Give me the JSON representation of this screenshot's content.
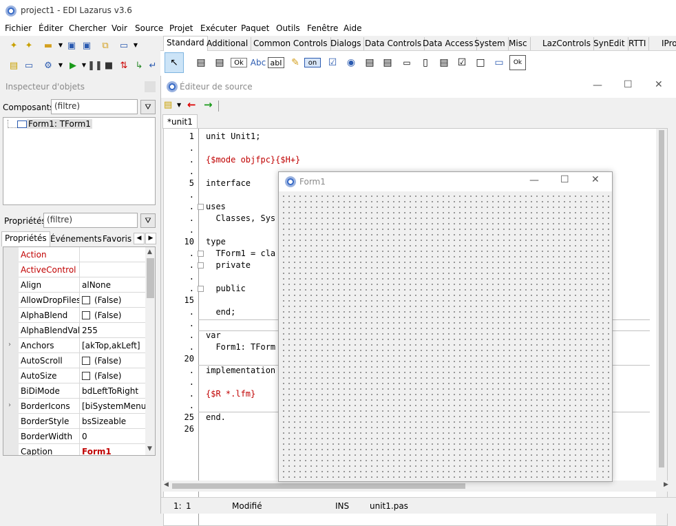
{
  "app": {
    "title": "project1 - EDI Lazarus v3.6"
  },
  "menu": [
    "Fichier",
    "Éditer",
    "Chercher",
    "Voir",
    "Source",
    "Projet",
    "Exécuter",
    "Paquet",
    "Outils",
    "Fenêtre",
    "Aide"
  ],
  "palette": {
    "tabs": [
      "Standard",
      "Additional",
      "Common Controls",
      "Dialogs",
      "Data Controls",
      "Data Access",
      "System",
      "Misc",
      "LazControls",
      "SynEdit",
      "RTTI",
      "IPro"
    ],
    "active_tab": "Standard",
    "icons": [
      "pointer-icon",
      "tmainmenu-icon",
      "tpopupmenu-icon",
      "tbutton-icon",
      "tlabel-icon",
      "tedit-icon",
      "tmemo-icon",
      "ttogglebox-icon",
      "tcheckbox-icon",
      "tradiobutton-icon",
      "tlistbox-icon",
      "tcombobox-icon",
      "tscrollbar-icon",
      "tgroupbox-icon",
      "tradiogroup-icon",
      "tcheckgroup-icon",
      "tpanel-icon",
      "tframe-icon",
      "tactionlist-icon"
    ],
    "labels": {
      "ok": "Ok",
      "abc": "Abc",
      "abi": "abI",
      "on": "on",
      "ok2": "Ok"
    }
  },
  "inspector": {
    "title": "Inspecteur d'objets",
    "components_label": "Composants",
    "filter_placeholder": "(filtre)",
    "tree_item": "Form1: TForm1",
    "properties_label": "Propriétés",
    "tabs": [
      "Propriétés",
      "Événements",
      "Favoris"
    ],
    "properties": [
      {
        "name": "Action",
        "value": "",
        "red": true
      },
      {
        "name": "ActiveControl",
        "value": "",
        "red": true
      },
      {
        "name": "Align",
        "value": "alNone"
      },
      {
        "name": "AllowDropFiles",
        "value": "(False)",
        "check": true
      },
      {
        "name": "AlphaBlend",
        "value": "(False)",
        "check": true
      },
      {
        "name": "AlphaBlendValu",
        "value": "255"
      },
      {
        "name": "Anchors",
        "value": "[akTop,akLeft]",
        "expand": true
      },
      {
        "name": "AutoScroll",
        "value": "(False)",
        "check": true
      },
      {
        "name": "AutoSize",
        "value": "(False)",
        "check": true
      },
      {
        "name": "BiDiMode",
        "value": "bdLeftToRight"
      },
      {
        "name": "BorderIcons",
        "value": "[biSystemMenu,I",
        "expand": true
      },
      {
        "name": "BorderStyle",
        "value": "bsSizeable"
      },
      {
        "name": "BorderWidth",
        "value": "0"
      },
      {
        "name": "Caption",
        "value": "Form1",
        "redval": true
      }
    ]
  },
  "editor": {
    "title": "Éditeur de source",
    "tab": "*unit1",
    "lines": [
      {
        "n": "1",
        "text": "unit Unit1;"
      },
      {
        "n": ".",
        "text": ""
      },
      {
        "n": ".",
        "text": "{$mode objfpc}{$H+}",
        "red": true
      },
      {
        "n": ".",
        "text": ""
      },
      {
        "n": "5",
        "text": "interface"
      },
      {
        "n": ".",
        "text": ""
      },
      {
        "n": ".",
        "text": "uses"
      },
      {
        "n": ".",
        "text": "  Classes, Sys"
      },
      {
        "n": ".",
        "text": ""
      },
      {
        "n": "10",
        "text": "type"
      },
      {
        "n": ".",
        "text": "  TForm1 = cla"
      },
      {
        "n": ".",
        "text": "  private"
      },
      {
        "n": ".",
        "text": ""
      },
      {
        "n": ".",
        "text": "  public"
      },
      {
        "n": "15",
        "text": ""
      },
      {
        "n": ".",
        "text": "  end;"
      },
      {
        "n": ".",
        "text": ""
      },
      {
        "n": ".",
        "text": "var"
      },
      {
        "n": ".",
        "text": "  Form1: TForm"
      },
      {
        "n": "20",
        "text": ""
      },
      {
        "n": ".",
        "text": "implementation"
      },
      {
        "n": ".",
        "text": ""
      },
      {
        "n": ".",
        "text": "{$R *.lfm}",
        "red": true
      },
      {
        "n": ".",
        "text": ""
      },
      {
        "n": "25",
        "text": "end."
      },
      {
        "n": "26",
        "text": ""
      }
    ],
    "status": {
      "pos_line": "1:",
      "pos_col": "1",
      "modified": "Modifié",
      "mode": "INS",
      "file": "unit1.pas"
    }
  },
  "form1": {
    "title": "Form1"
  },
  "colors": {
    "red_text": "#c00000",
    "accent": "#3a6cc7"
  }
}
